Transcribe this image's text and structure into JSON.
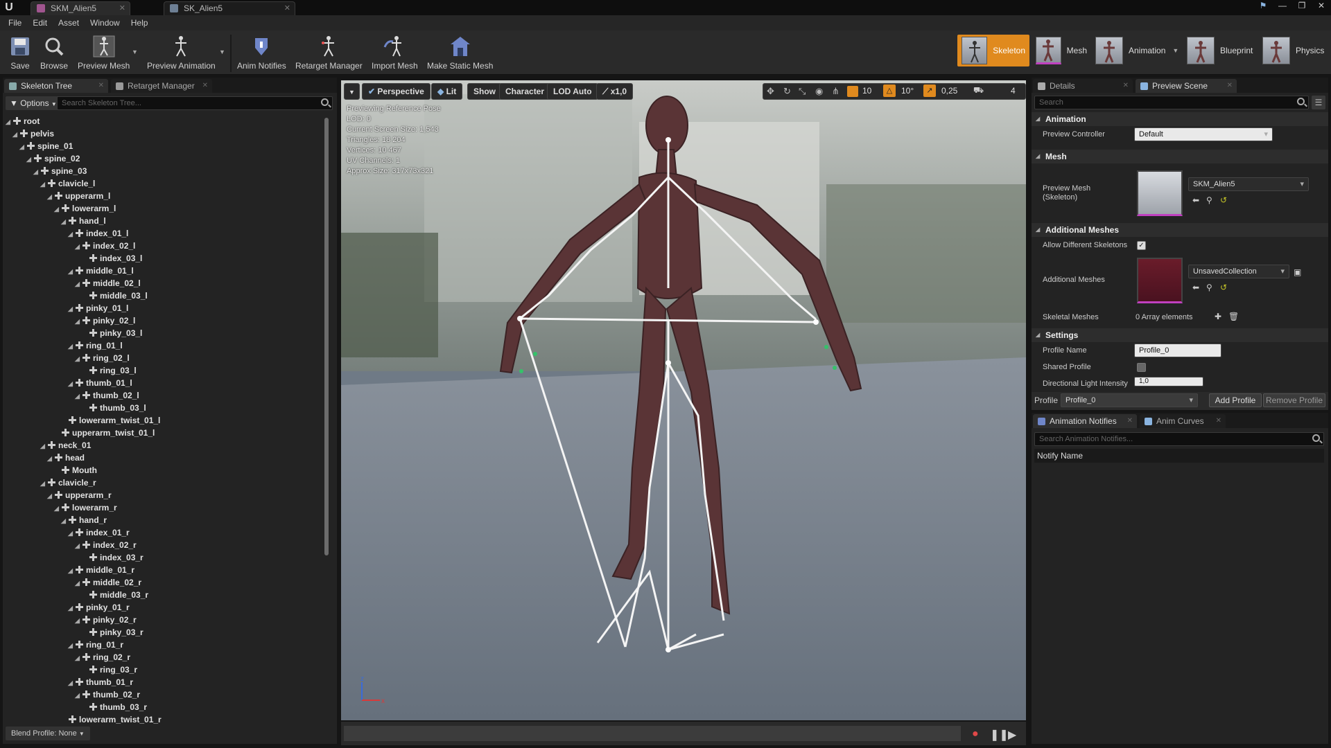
{
  "tabs": {
    "doc1": "SKM_Alien5",
    "doc2": "SK_Alien5"
  },
  "menu": [
    "File",
    "Edit",
    "Asset",
    "Window",
    "Help"
  ],
  "toolbar": {
    "save": "Save",
    "browse": "Browse",
    "preview_mesh": "Preview Mesh",
    "preview_animation": "Preview Animation",
    "anim_notifies": "Anim Notifies",
    "retarget_manager": "Retarget Manager",
    "import_mesh": "Import Mesh",
    "make_static_mesh": "Make Static Mesh"
  },
  "modes": {
    "skeleton": "Skeleton",
    "mesh": "Mesh",
    "animation": "Animation",
    "blueprint": "Blueprint",
    "physics": "Physics"
  },
  "left_panel": {
    "tab1": "Skeleton Tree",
    "tab2": "Retarget Manager",
    "options": "Options",
    "search_placeholder": "Search Skeleton Tree...",
    "blend_profile": "Blend Profile: None"
  },
  "tree": [
    {
      "label": "root",
      "depth": 0,
      "exp": true
    },
    {
      "label": "pelvis",
      "depth": 1,
      "exp": true
    },
    {
      "label": "spine_01",
      "depth": 2,
      "exp": true
    },
    {
      "label": "spine_02",
      "depth": 3,
      "exp": true
    },
    {
      "label": "spine_03",
      "depth": 4,
      "exp": true
    },
    {
      "label": "clavicle_l",
      "depth": 5,
      "exp": true
    },
    {
      "label": "upperarm_l",
      "depth": 6,
      "exp": true
    },
    {
      "label": "lowerarm_l",
      "depth": 7,
      "exp": true
    },
    {
      "label": "hand_l",
      "depth": 8,
      "exp": true
    },
    {
      "label": "index_01_l",
      "depth": 9,
      "exp": true
    },
    {
      "label": "index_02_l",
      "depth": 10,
      "exp": true
    },
    {
      "label": "index_03_l",
      "depth": 11,
      "exp": false
    },
    {
      "label": "middle_01_l",
      "depth": 9,
      "exp": true
    },
    {
      "label": "middle_02_l",
      "depth": 10,
      "exp": true
    },
    {
      "label": "middle_03_l",
      "depth": 11,
      "exp": false
    },
    {
      "label": "pinky_01_l",
      "depth": 9,
      "exp": true
    },
    {
      "label": "pinky_02_l",
      "depth": 10,
      "exp": true
    },
    {
      "label": "pinky_03_l",
      "depth": 11,
      "exp": false
    },
    {
      "label": "ring_01_l",
      "depth": 9,
      "exp": true
    },
    {
      "label": "ring_02_l",
      "depth": 10,
      "exp": true
    },
    {
      "label": "ring_03_l",
      "depth": 11,
      "exp": false
    },
    {
      "label": "thumb_01_l",
      "depth": 9,
      "exp": true
    },
    {
      "label": "thumb_02_l",
      "depth": 10,
      "exp": true
    },
    {
      "label": "thumb_03_l",
      "depth": 11,
      "exp": false
    },
    {
      "label": "lowerarm_twist_01_l",
      "depth": 8,
      "exp": false
    },
    {
      "label": "upperarm_twist_01_l",
      "depth": 7,
      "exp": false
    },
    {
      "label": "neck_01",
      "depth": 5,
      "exp": true
    },
    {
      "label": "head",
      "depth": 6,
      "exp": true
    },
    {
      "label": "Mouth",
      "depth": 7,
      "exp": false
    },
    {
      "label": "clavicle_r",
      "depth": 5,
      "exp": true
    },
    {
      "label": "upperarm_r",
      "depth": 6,
      "exp": true
    },
    {
      "label": "lowerarm_r",
      "depth": 7,
      "exp": true
    },
    {
      "label": "hand_r",
      "depth": 8,
      "exp": true
    },
    {
      "label": "index_01_r",
      "depth": 9,
      "exp": true
    },
    {
      "label": "index_02_r",
      "depth": 10,
      "exp": true
    },
    {
      "label": "index_03_r",
      "depth": 11,
      "exp": false
    },
    {
      "label": "middle_01_r",
      "depth": 9,
      "exp": true
    },
    {
      "label": "middle_02_r",
      "depth": 10,
      "exp": true
    },
    {
      "label": "middle_03_r",
      "depth": 11,
      "exp": false
    },
    {
      "label": "pinky_01_r",
      "depth": 9,
      "exp": true
    },
    {
      "label": "pinky_02_r",
      "depth": 10,
      "exp": true
    },
    {
      "label": "pinky_03_r",
      "depth": 11,
      "exp": false
    },
    {
      "label": "ring_01_r",
      "depth": 9,
      "exp": true
    },
    {
      "label": "ring_02_r",
      "depth": 10,
      "exp": true
    },
    {
      "label": "ring_03_r",
      "depth": 11,
      "exp": false
    },
    {
      "label": "thumb_01_r",
      "depth": 9,
      "exp": true
    },
    {
      "label": "thumb_02_r",
      "depth": 10,
      "exp": true
    },
    {
      "label": "thumb_03_r",
      "depth": 11,
      "exp": false
    },
    {
      "label": "lowerarm_twist_01_r",
      "depth": 8,
      "exp": false
    }
  ],
  "viewport": {
    "perspective": "Perspective",
    "lit": "Lit",
    "show": "Show",
    "character": "Character",
    "lod": "LOD Auto",
    "speed": "x1,0",
    "grid": "10",
    "rot": "10°",
    "scale": "0,25",
    "cam": "4",
    "info": [
      "Previewing Reference Pose",
      "LOD: 0",
      "Current Screen Size: 1,543",
      "Triangles: 18 204",
      "Vertices: 10 467",
      "UV Channels: 1",
      "Approx Size: 317x73x321"
    ]
  },
  "details": {
    "tab1": "Details",
    "tab2": "Preview Scene Sett",
    "search_placeholder": "Search",
    "animation_header": "Animation",
    "preview_controller_label": "Preview Controller",
    "preview_controller_value": "Default",
    "mesh_header": "Mesh",
    "preview_mesh_label": "Preview Mesh (Skeleton)",
    "preview_mesh_value": "SKM_Alien5",
    "additional_header": "Additional Meshes",
    "allow_diff_label": "Allow Different Skeletons",
    "additional_label": "Additional Meshes",
    "additional_value": "UnsavedCollection",
    "skeletal_label": "Skeletal Meshes",
    "skeletal_value": "0 Array elements",
    "settings_header": "Settings",
    "profile_name_label": "Profile Name",
    "profile_name_value": "Profile_0",
    "shared_label": "Shared Profile",
    "dir_light_label": "Directional Light Intensity",
    "dir_light_value": "1,0",
    "profile_label": "Profile",
    "profile_value": "Profile_0",
    "add_profile": "Add Profile",
    "remove_profile": "Remove Profile"
  },
  "notifies": {
    "tab1": "Animation Notifies",
    "tab2": "Anim Curves",
    "search_placeholder": "Search Animation Notifies...",
    "col": "Notify Name"
  },
  "colors": {
    "accent": "#e08a1e",
    "panel": "#232323",
    "bg": "#151515"
  }
}
